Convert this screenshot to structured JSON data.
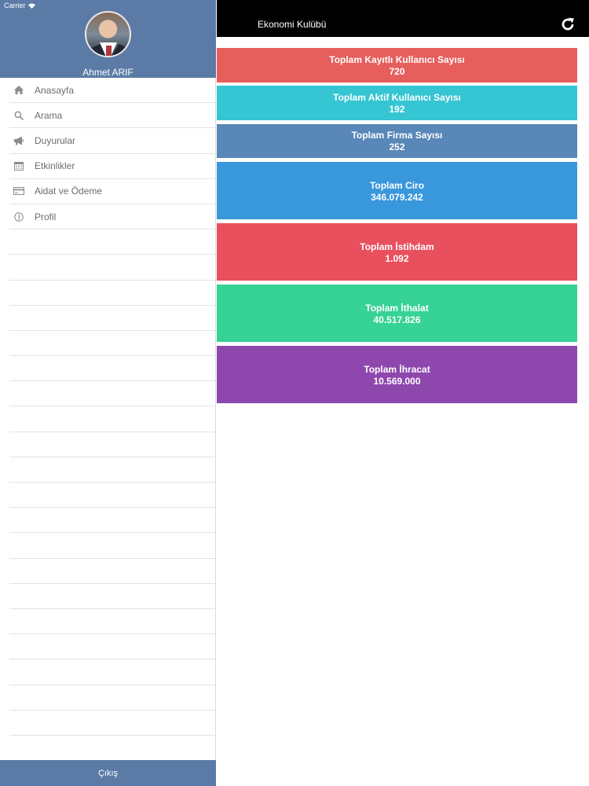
{
  "status": {
    "carrier": "Carrier"
  },
  "profile": {
    "name": "Ahmet ARIF"
  },
  "menu": [
    {
      "label": "Anasayfa",
      "icon": "home-icon"
    },
    {
      "label": "Arama",
      "icon": "search-icon"
    },
    {
      "label": "Duyurular",
      "icon": "megaphone-icon"
    },
    {
      "label": "Etkinlikler",
      "icon": "calendar-icon"
    },
    {
      "label": "Aidat ve Ödeme",
      "icon": "credit-card-icon"
    },
    {
      "label": "Profil",
      "icon": "info-icon"
    }
  ],
  "logout_label": "Çıkış",
  "navbar": {
    "title": "Ekonomi Kulübü",
    "refresh_icon": "refresh-icon"
  },
  "stats": [
    {
      "label": "Toplam Kayıtlı Kullanıcı Sayısı",
      "value": "720",
      "color": "#e65f5c"
    },
    {
      "label": "Toplam Aktif Kullanıcı Sayısı",
      "value": "192",
      "color": "#35c5d3"
    },
    {
      "label": "Toplam Firma Sayısı",
      "value": "252",
      "color": "#5887b8"
    },
    {
      "label": "Toplam Ciro",
      "value": "346.079.242",
      "color": "#3997db"
    },
    {
      "label": "Toplam İstihdam",
      "value": "1.092",
      "color": "#e8505e"
    },
    {
      "label": "Toplam İthalat",
      "value": "40.517.826",
      "color": "#36d296"
    },
    {
      "label": "Toplam İhracat",
      "value": "10.569.000",
      "color": "#8e47ad"
    }
  ],
  "colors": {
    "sidebar_header": "#5b7ba6",
    "navbar": "#000000"
  }
}
